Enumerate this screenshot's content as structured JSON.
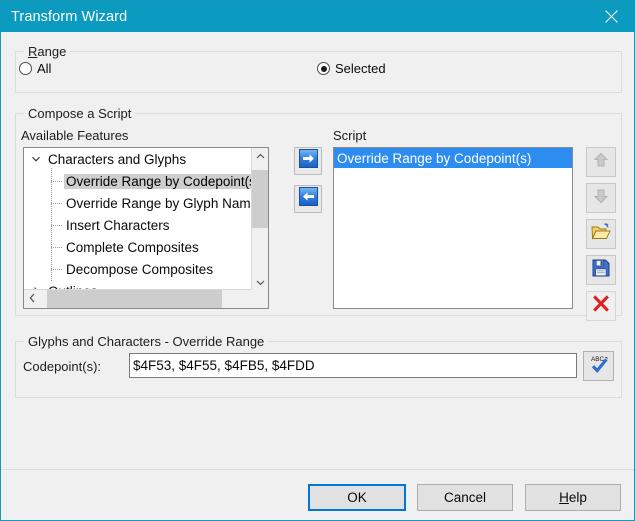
{
  "window": {
    "title": "Transform Wizard",
    "titlebar_color": "#0b9ac0",
    "border_color": "#1798b8",
    "close_icon": "close-icon"
  },
  "range_group": {
    "title": "Range",
    "title_accel": "R",
    "options": [
      {
        "label": "All",
        "checked": false
      },
      {
        "label": "Selected",
        "checked": true
      }
    ]
  },
  "compose_group": {
    "title": "Compose a Script",
    "available_label": "Available Features",
    "script_label": "Script",
    "tree": {
      "items": [
        {
          "label": "Characters and Glyphs",
          "level": 0,
          "expanded": true,
          "selected": false
        },
        {
          "label": "Override Range by Codepoint(s)",
          "level": 1,
          "selected": true
        },
        {
          "label": "Override Range by Glyph Name(s)",
          "level": 1,
          "selected": false
        },
        {
          "label": "Insert Characters",
          "level": 1,
          "selected": false
        },
        {
          "label": "Complete Composites",
          "level": 1,
          "selected": false
        },
        {
          "label": "Decompose Composites",
          "level": 1,
          "selected": false
        },
        {
          "label": "Outlines",
          "level": 0,
          "expanded": false,
          "selected": false
        }
      ],
      "vscroll_up_icon": "chevron-up-icon",
      "vscroll_down_icon": "chevron-down-icon",
      "hscroll_left_icon": "chevron-left-icon",
      "hscroll_right_icon": "chevron-right-icon"
    },
    "script_list": {
      "items": [
        {
          "label": "Override Range by Codepoint(s)",
          "selected": true
        }
      ],
      "selection_color": "#2c8cf0"
    },
    "transfer_buttons": [
      {
        "name": "add-to-script-button",
        "icon": "arrow-right-icon"
      },
      {
        "name": "remove-from-script-button",
        "icon": "arrow-left-icon"
      }
    ],
    "tool_buttons": [
      {
        "name": "move-up-button",
        "icon": "arrow-up-icon",
        "enabled": false
      },
      {
        "name": "move-down-button",
        "icon": "arrow-down-icon",
        "enabled": false
      },
      {
        "name": "open-script-button",
        "icon": "folder-open-icon",
        "enabled": true
      },
      {
        "name": "save-script-button",
        "icon": "floppy-disk-icon",
        "enabled": true
      },
      {
        "name": "delete-script-button",
        "icon": "red-x-icon",
        "enabled": true
      }
    ]
  },
  "glyphs_group": {
    "title": "Glyphs and Characters - Override Range",
    "codepoint_label": "Codepoint(s):",
    "codepoint_value": "$4F53, $4F55, $4FB5, $4FDD",
    "codepoint_placeholder": "",
    "spellcheck_icon": "abc-check-icon"
  },
  "footer": {
    "ok_label": "OK",
    "cancel_label": "Cancel",
    "help_label": "Help",
    "help_accel": "H",
    "focus_color": "#0078d7"
  }
}
